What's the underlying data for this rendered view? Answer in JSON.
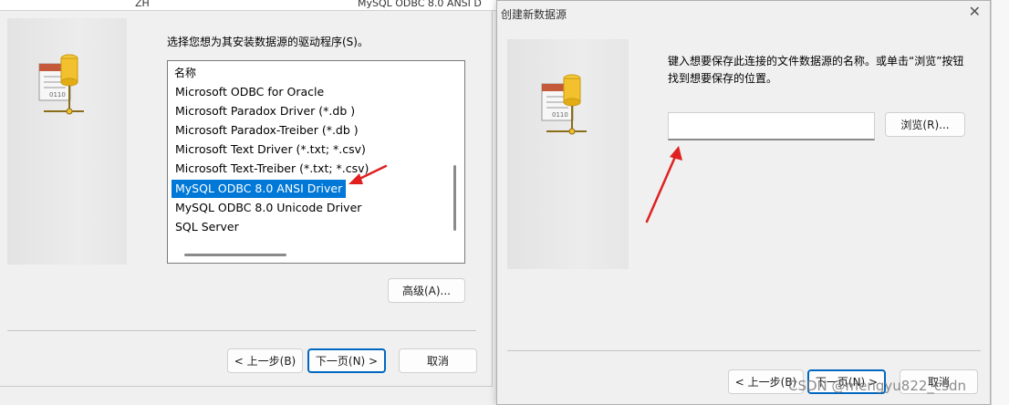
{
  "background": {
    "strip_left": "ZH",
    "strip_mid": "MySQL ODBC 8.0 ANSI D"
  },
  "left_dialog": {
    "prompt": "选择您想为其安装数据源的驱动程序(S)。",
    "list": {
      "header": "名称",
      "items": [
        "Microsoft ODBC for Oracle",
        "Microsoft Paradox Driver (*.db )",
        "Microsoft Paradox-Treiber (*.db )",
        "Microsoft Text Driver (*.txt; *.csv)",
        "Microsoft Text-Treiber (*.txt; *.csv)",
        "MySQL ODBC 8.0 ANSI Driver",
        "MySQL ODBC 8.0 Unicode Driver",
        "SQL Server"
      ],
      "selected_index": 5
    },
    "advanced_label": "高级(A)...",
    "back_label": "< 上一步(B)",
    "next_label": "下一页(N) >",
    "cancel_label": "取消"
  },
  "right_dialog": {
    "title": "创建新数据源",
    "close_label": "✕",
    "description": "键入想要保存此连接的文件数据源的名称。或单击“浏览”按钮找到想要保存的位置。",
    "filename_value": "",
    "browse_label": "浏览(R)...",
    "back_label": "< 上一步(B)",
    "next_label": "下一页(N) >",
    "cancel_label": "取消"
  },
  "watermark": "CSDN @mengyu822_csdn",
  "colors": {
    "selection": "#0078d7",
    "annotation_arrow": "#e02020",
    "default_button_border": "#0067c0"
  }
}
